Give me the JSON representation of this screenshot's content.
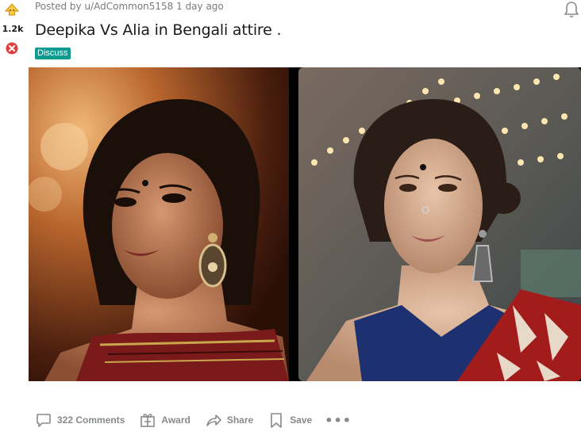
{
  "post": {
    "score": "1.2k",
    "posted_by": "Posted by u/AdCommon5158 1 day ago",
    "title": "Deepika Vs Alia in Bengali attire .",
    "flair": "Discuss"
  },
  "media": {
    "left_image_subject": "woman in red saree with dark bindi and chandbali earring",
    "right_image_subject": "woman in blue blouse and red saree with bindi and nose pin"
  },
  "actions": {
    "comments_label": "322 Comments",
    "award_label": "Award",
    "share_label": "Share",
    "save_label": "Save",
    "more_label": "•••"
  },
  "colors": {
    "flair_bg": "#0e9a8e",
    "meta_text": "#787c7e",
    "action_text": "#878a8c",
    "upvote": "#f0a020",
    "downvote": "#e04040"
  }
}
